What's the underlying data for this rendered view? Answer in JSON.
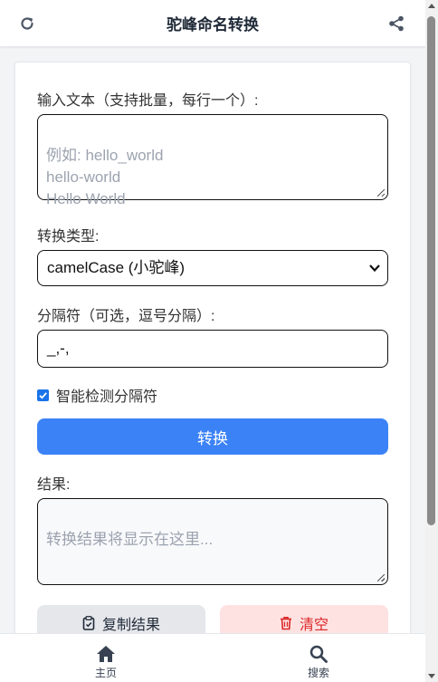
{
  "header": {
    "title": "驼峰命名转换",
    "left_icon": "refresh-icon",
    "right_icon": "share-icon"
  },
  "input": {
    "label": "输入文本（支持批量，每行一个）:",
    "placeholder": "例如: hello_world\nhello-world\nHello World"
  },
  "convert_type": {
    "label": "转换类型:",
    "selected": "camelCase (小驼峰)"
  },
  "separator": {
    "label": "分隔符（可选，逗号分隔）:",
    "value": "_,-,"
  },
  "smart_detect": {
    "label": "智能检测分隔符",
    "checked": true
  },
  "convert_button": {
    "label": "转换"
  },
  "result": {
    "label": "结果:",
    "placeholder": "转换结果将显示在这里..."
  },
  "actions": {
    "copy_label": "复制结果",
    "clear_label": "清空"
  },
  "bottom_nav": {
    "items": [
      {
        "label": "主页",
        "icon": "home-icon"
      },
      {
        "label": "搜索",
        "icon": "search-icon"
      }
    ]
  },
  "colors": {
    "accent": "#3b82f6",
    "danger": "#dc2626",
    "danger_bg": "#fee2e2",
    "neutral_bg": "#e5e7eb"
  }
}
